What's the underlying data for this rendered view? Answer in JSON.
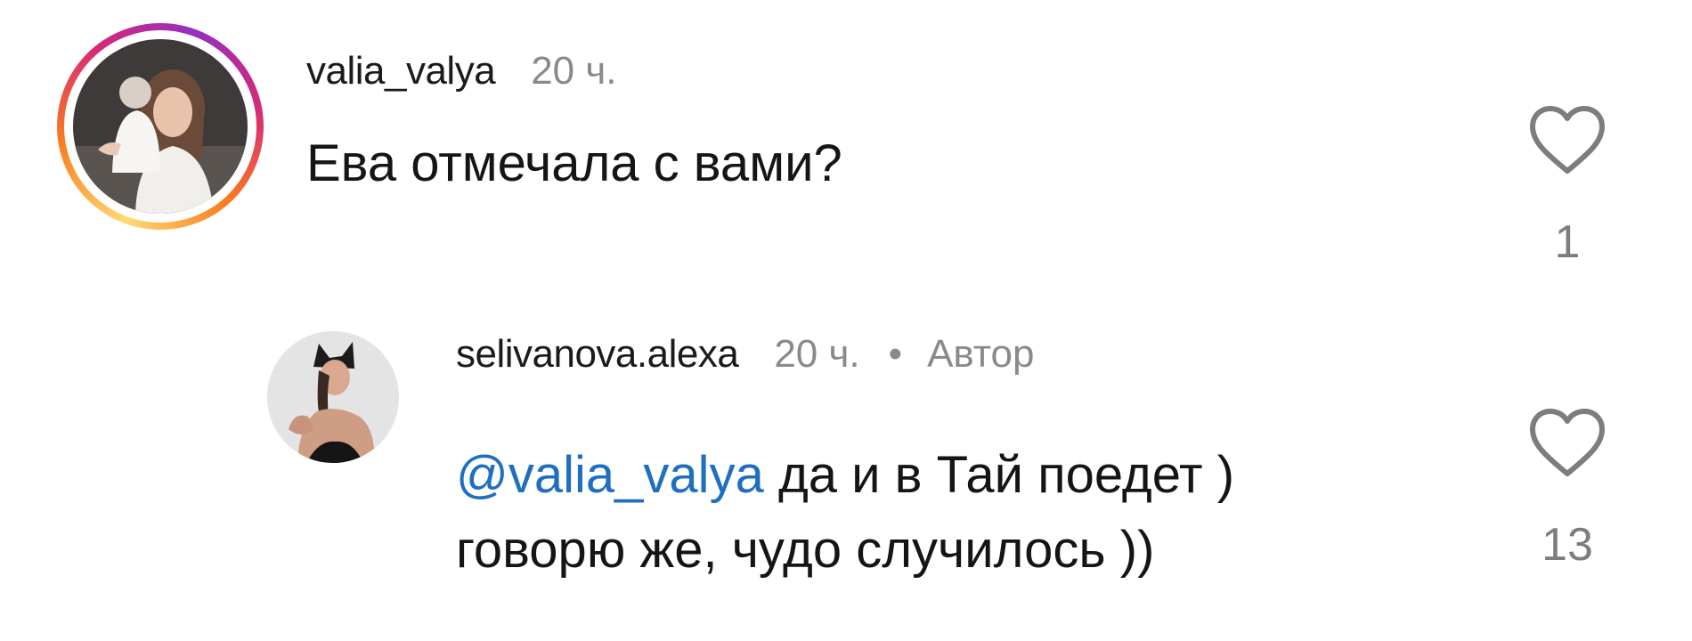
{
  "comments": [
    {
      "username": "valia_valya",
      "time": "20 ч.",
      "text": "Ева отмечала с вами?",
      "likes": "1",
      "avatar_icon": "user-avatar-photo",
      "story_ring": true
    },
    {
      "username": "selivanova.alexa",
      "time": "20 ч.",
      "separator": "•",
      "author_label": "Автор",
      "mention": "@valia_valya",
      "text_line1": "да и в Тай поедет )",
      "text_line2": "говорю же, чудо случилось ))",
      "likes": "13",
      "avatar_icon": "user-avatar-photo"
    }
  ],
  "icons": {
    "like": "heart-outline-icon"
  },
  "colors": {
    "mention": "#1f6fc1",
    "secondary_text": "#8a8a8a",
    "story_ring": [
      "#feda75",
      "#fa7e1e",
      "#d62976",
      "#962fbf"
    ]
  }
}
